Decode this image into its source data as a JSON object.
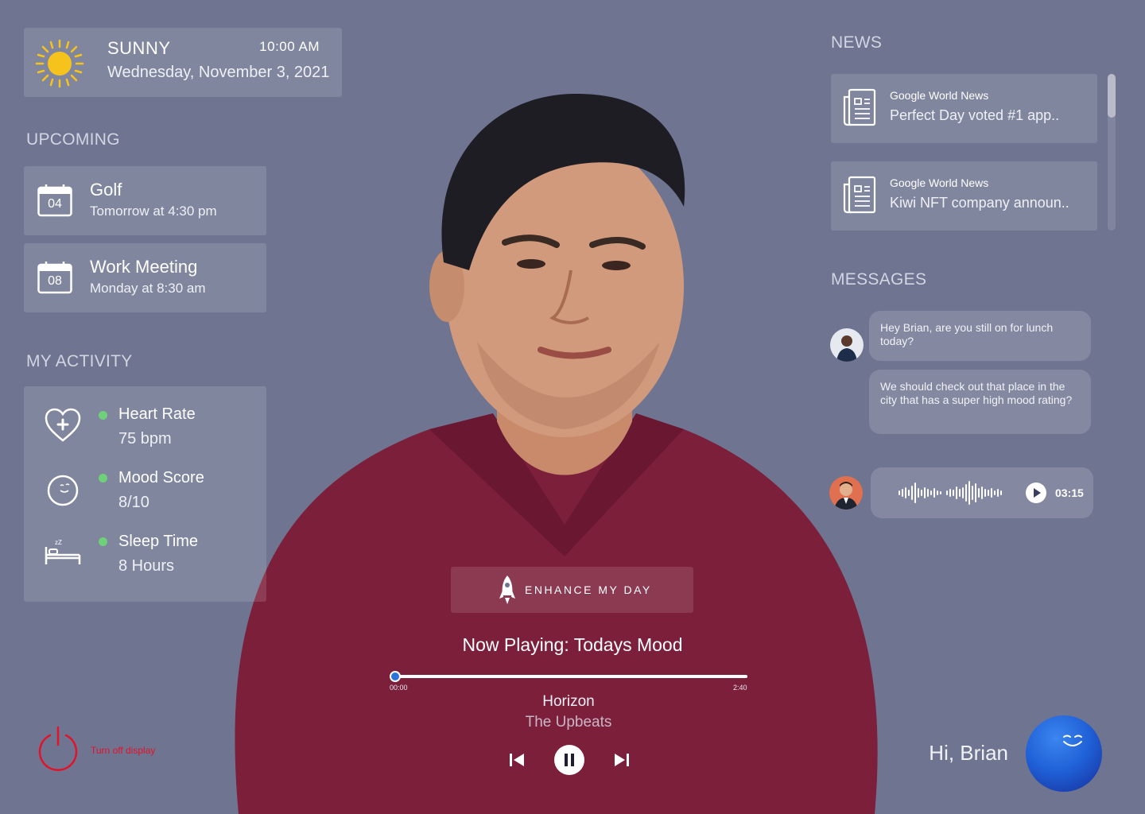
{
  "weather": {
    "condition": "SUNNY",
    "time": "10:00 AM",
    "date": "Wednesday, November 3, 2021",
    "icon": "sun-icon"
  },
  "upcoming": {
    "title": "UPCOMING",
    "events": [
      {
        "day": "04",
        "title": "Golf",
        "when": "Tomorrow at 4:30 pm"
      },
      {
        "day": "08",
        "title": "Work Meeting",
        "when": "Monday at 8:30 am"
      }
    ]
  },
  "activity": {
    "title": "MY ACTIVITY",
    "items": [
      {
        "label": "Heart Rate",
        "value": "75 bpm",
        "icon": "heart-plus-icon"
      },
      {
        "label": "Mood Score",
        "value": "8/10",
        "icon": "smiley-icon"
      },
      {
        "label": "Sleep Time",
        "value": "8 Hours",
        "icon": "bed-icon"
      }
    ]
  },
  "news": {
    "title": "NEWS",
    "items": [
      {
        "source": "Google World News",
        "headline": "Perfect Day voted #1 app.."
      },
      {
        "source": "Google World News",
        "headline": "Kiwi NFT company announ.."
      }
    ]
  },
  "messages": {
    "title": "MESSAGES",
    "bubbles": [
      "Hey Brian, are you still on for lunch today?",
      "We should check out that place in the city that has a super high mood rating?"
    ],
    "voice_duration": "03:15"
  },
  "player": {
    "enhance_label": "ENHANCE MY DAY",
    "now_playing": "Now Playing: Todays Mood",
    "elapsed": "00:00",
    "total": "2:40",
    "song": "Horizon",
    "artist": "The Upbeats",
    "progress": 0.0
  },
  "footer": {
    "power_label": "Turn off display",
    "greeting": "Hi, Brian"
  },
  "colors": {
    "background": "#6f7491",
    "accent": "#2b73d8",
    "status_dot": "#6fd07a",
    "power": "#e2122a",
    "shirt": "#7c1f3b"
  }
}
